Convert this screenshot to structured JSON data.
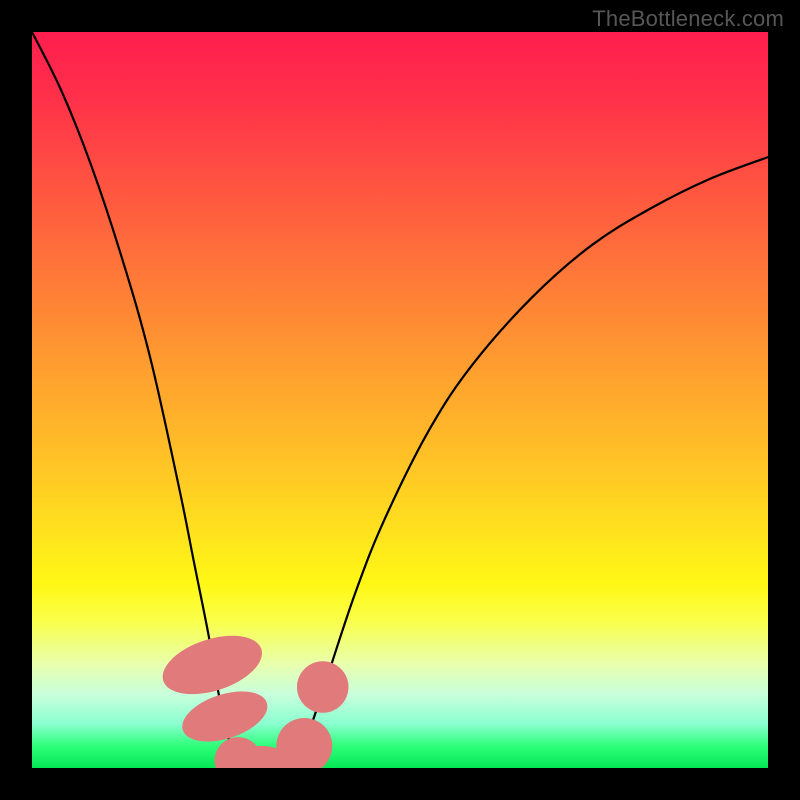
{
  "watermark": "TheBottleneck.com",
  "colors": {
    "page_bg": "#000000",
    "curve_stroke": "#000000",
    "marker_fill": "#e17a7a",
    "watermark_text": "#575757"
  },
  "chart_data": {
    "type": "line",
    "title": "",
    "xlabel": "",
    "ylabel": "",
    "xlim": [
      0,
      100
    ],
    "ylim": [
      0,
      100
    ],
    "grid": false,
    "legend": false,
    "note": "Two smooth curves over a vertical red→green gradient. Y is bottleneck percent (100 at top, 0 at bottom). X is a normalized hardware-balance axis. Left curve falls steeply from top-left to a flat floor near x≈27–36; right curve rises from that same floor toward the top-right with decreasing slope. Pink markers sit on the curves near the floor.",
    "series": [
      {
        "name": "left-curve",
        "x": [
          0,
          4,
          8,
          12,
          16,
          20,
          22,
          24,
          25,
          26,
          27,
          28,
          30,
          32,
          34,
          36
        ],
        "y": [
          100,
          92,
          82,
          70,
          56,
          38,
          28,
          18,
          12,
          7,
          3,
          1,
          0,
          0,
          0,
          0
        ]
      },
      {
        "name": "right-curve",
        "x": [
          30,
          34,
          36,
          38,
          40,
          44,
          48,
          54,
          60,
          68,
          76,
          84,
          92,
          100
        ],
        "y": [
          0,
          0,
          1,
          6,
          12,
          24,
          34,
          46,
          55,
          64,
          71,
          76,
          80,
          83
        ]
      }
    ],
    "markers": [
      {
        "shape": "pill",
        "x": 24.5,
        "y": 14,
        "rx": 3.5,
        "ry": 7,
        "angle": 72
      },
      {
        "shape": "pill",
        "x": 26.2,
        "y": 7,
        "rx": 3.0,
        "ry": 6,
        "angle": 72
      },
      {
        "shape": "circle",
        "x": 28.0,
        "y": 1,
        "r": 3.2
      },
      {
        "shape": "pill",
        "x": 31.0,
        "y": 0,
        "rx": 5.0,
        "ry": 3.0,
        "angle": 0
      },
      {
        "shape": "pill",
        "x": 35.0,
        "y": 0,
        "rx": 4.0,
        "ry": 2.8,
        "angle": 0
      },
      {
        "shape": "circle",
        "x": 37.0,
        "y": 3,
        "r": 3.8
      },
      {
        "shape": "circle",
        "x": 39.5,
        "y": 11,
        "r": 3.5
      }
    ],
    "gradient_stops": [
      {
        "pos": 0.0,
        "color": "#ff1e4e"
      },
      {
        "pos": 0.34,
        "color": "#ff7b38"
      },
      {
        "pos": 0.68,
        "color": "#ffe21e"
      },
      {
        "pos": 0.88,
        "color": "#d8ffc8"
      },
      {
        "pos": 1.0,
        "color": "#05e755"
      }
    ]
  }
}
